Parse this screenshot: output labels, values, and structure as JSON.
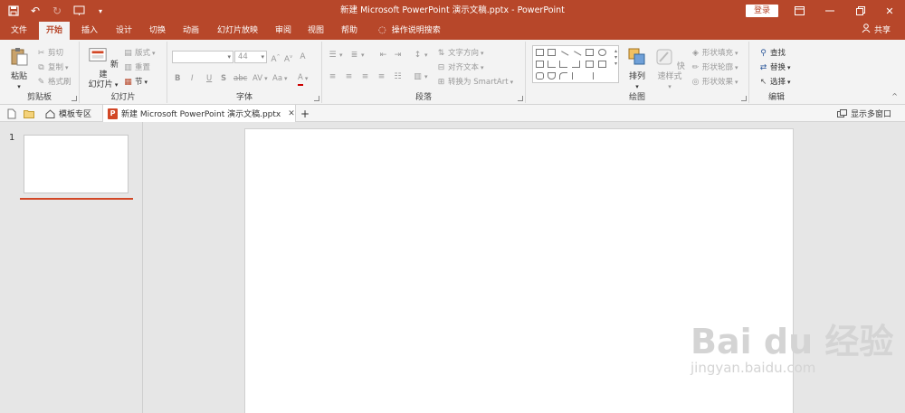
{
  "window": {
    "title": "新建 Microsoft PowerPoint 演示文稿.pptx  -  PowerPoint",
    "login_label": "登录",
    "share_label": "共享"
  },
  "tabs": [
    "文件",
    "开始",
    "插入",
    "设计",
    "切换",
    "动画",
    "幻灯片放映",
    "审阅",
    "视图",
    "帮助",
    "操作说明搜索"
  ],
  "active_tab": "开始",
  "ribbon": {
    "clipboard": {
      "label": "剪贴板",
      "paste": "粘贴",
      "cut": "剪切",
      "copy": "复制",
      "format_painter": "格式刷"
    },
    "slides": {
      "label": "幻灯片",
      "new_slide_1": "新建",
      "new_slide_2": "幻灯片",
      "layout": "版式",
      "reset": "重置",
      "section": "节"
    },
    "font": {
      "label": "字体",
      "font_name": "",
      "font_size": "44",
      "bold": "B",
      "italic": "I",
      "underline": "U",
      "shadow": "S",
      "strike": "abc",
      "spacing": "AV",
      "case": "Aa",
      "color": "A"
    },
    "paragraph": {
      "label": "段落",
      "text_direction": "文字方向",
      "align_text": "对齐文本",
      "smartart": "转换为 SmartArt"
    },
    "drawing": {
      "label": "绘图",
      "arrange": "排列",
      "quick_styles": "快速样式",
      "shape_fill": "形状填充",
      "shape_outline": "形状轮廓",
      "shape_effects": "形状效果"
    },
    "editing": {
      "label": "编辑",
      "find": "查找",
      "replace": "替换",
      "select": "选择"
    }
  },
  "docbar": {
    "template_zone": "模板专区",
    "doc_tab": "新建 Microsoft PowerPoint 演示文稿.pptx",
    "show_multi_window": "显示多窗口"
  },
  "slides_panel": {
    "slide_number": "1"
  },
  "watermark": {
    "brand": "Bai du 经验",
    "url": "jingyan.baidu.com"
  },
  "colors": {
    "accent": "#b7472a",
    "workspace": "#e6e6e6",
    "ribbon": "#f3f3f3"
  }
}
